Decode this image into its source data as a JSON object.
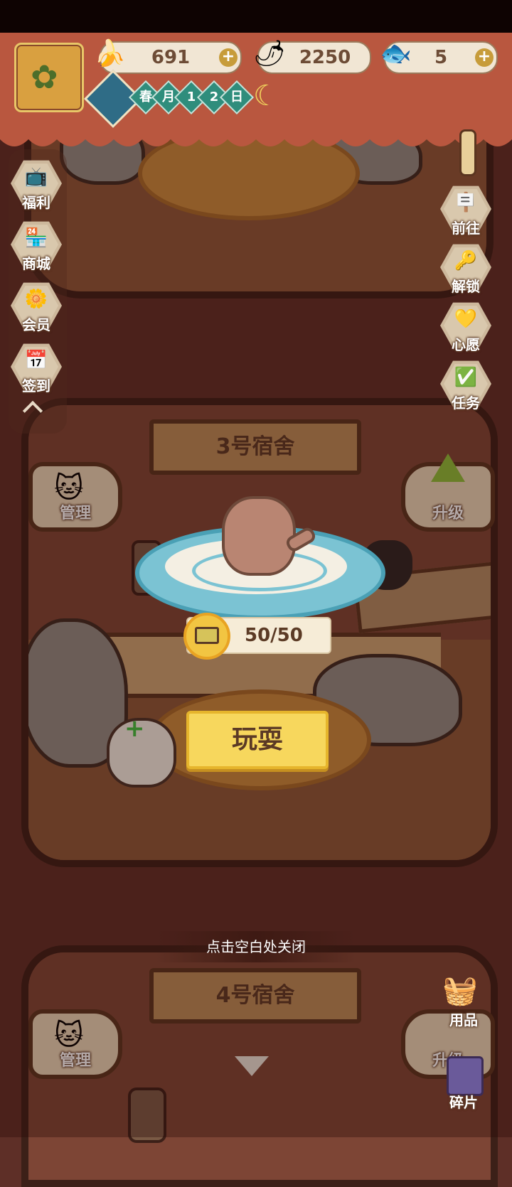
{
  "top": {
    "resources": [
      {
        "name": "banana-icon",
        "value": "691",
        "has_plus": true
      },
      {
        "name": "fire-pepper-icon",
        "value": "2250",
        "has_plus": false
      },
      {
        "name": "blue-fish-icon",
        "value": "5",
        "has_plus": true
      }
    ],
    "date": {
      "season": "春",
      "month": "月",
      "day_digits": [
        "1",
        "2"
      ],
      "day": "日"
    }
  },
  "left_menu": [
    {
      "label": "福利",
      "icon": "tv-icon"
    },
    {
      "label": "商城",
      "icon": "shop-icon"
    },
    {
      "label": "会员",
      "icon": "flower-badge-icon"
    },
    {
      "label": "签到",
      "icon": "calendar-icon"
    }
  ],
  "right_menu": [
    {
      "label": "前往",
      "icon": "signboard-icon"
    },
    {
      "label": "解锁",
      "icon": "key-icon"
    },
    {
      "label": "心愿",
      "icon": "heart-book-icon"
    },
    {
      "label": "任务",
      "icon": "task-icon"
    }
  ],
  "room3": {
    "title": "3号宿舍",
    "manage_label": "管理",
    "upgrade_label": "升级"
  },
  "popup": {
    "energy": "50/50",
    "play_label": "玩耍",
    "close_hint": "点击空白处关闭"
  },
  "room4": {
    "title": "4号宿舍",
    "manage_label": "管理",
    "upgrade_label": "升级"
  },
  "bottom_right": [
    {
      "label": "用品",
      "icon": "supplies-icon"
    },
    {
      "label": "碎片",
      "icon": "cat-card-icon"
    }
  ],
  "colors": {
    "background": "#5e2f27",
    "header": "#b9573f",
    "play_button": "#f7d75d",
    "platform": "#7bc3d3"
  }
}
